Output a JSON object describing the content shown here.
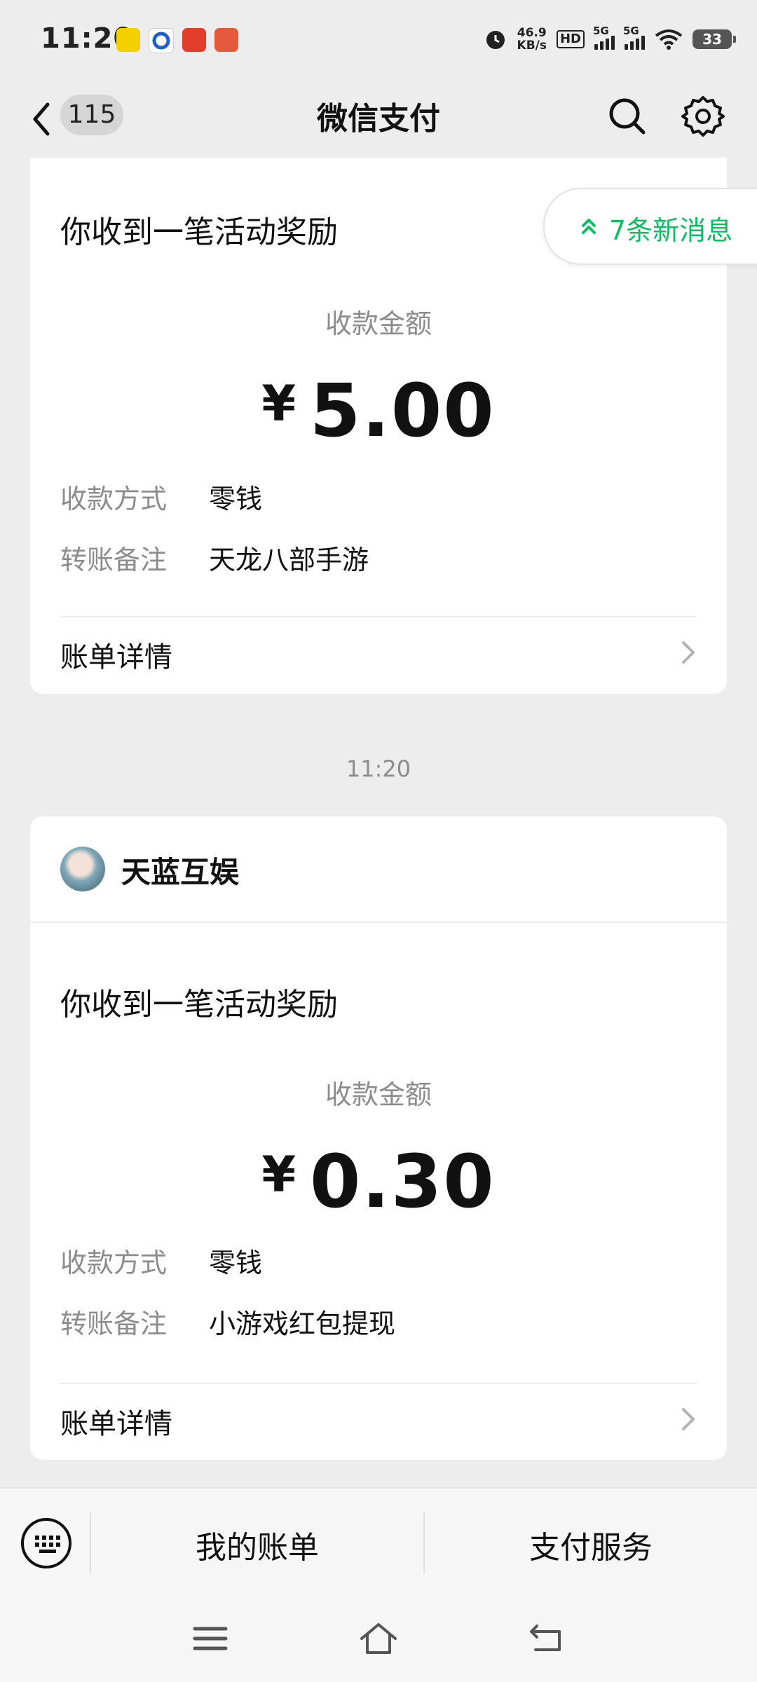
{
  "status_bar": {
    "time": "11:20",
    "net_speed_value": "46.9",
    "net_speed_unit": "KB/s",
    "hd_label": "HD",
    "signal_1_label": "5G",
    "signal_2_label": "5G",
    "battery": "33"
  },
  "header": {
    "unread_count": "115",
    "title": "微信支付"
  },
  "new_messages": {
    "label": "7条新消息"
  },
  "cards": [
    {
      "heading": "你收到一笔活动奖励",
      "amount_label": "收款金额",
      "currency": "¥",
      "amount": "5.00",
      "method_key": "收款方式",
      "method_value": "零钱",
      "note_key": "转账备注",
      "note_value": "天龙八部手游",
      "bill_link": "账单详情"
    },
    {
      "sender": "天蓝互娱",
      "heading": "你收到一笔活动奖励",
      "amount_label": "收款金额",
      "currency": "¥",
      "amount": "0.30",
      "method_key": "收款方式",
      "method_value": "零钱",
      "note_key": "转账备注",
      "note_value": "小游戏红包提现",
      "bill_link": "账单详情"
    }
  ],
  "timestamp": "11:20",
  "bottom_bar": {
    "my_bills": "我的账单",
    "pay_services": "支付服务"
  },
  "colors": {
    "accent": "#07c160",
    "background": "#ededed",
    "secondary_text": "#8c8c8c"
  }
}
